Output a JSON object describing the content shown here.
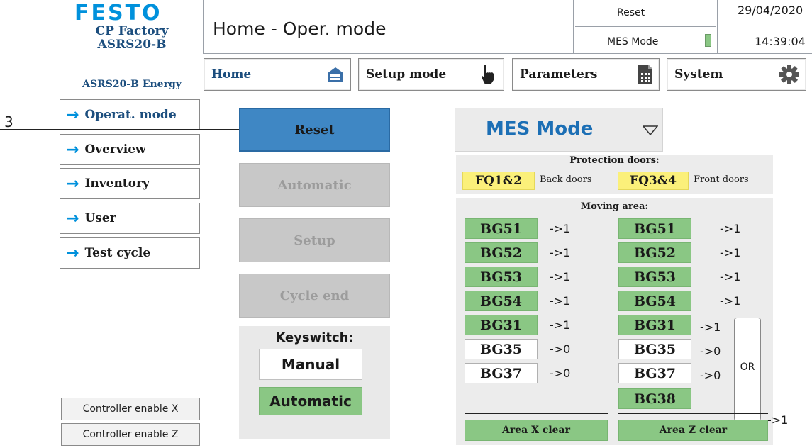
{
  "header": {
    "brand": "FESTO",
    "line1": "CP Factory",
    "line2": "ASRS20-B",
    "line3": "ASRS20-B Energy",
    "title": "Home - Oper. mode",
    "reset": "Reset",
    "mes_mode": "MES Mode",
    "date": "29/04/2020",
    "time": "14:39:04"
  },
  "nav": {
    "home": "Home",
    "setup": "Setup mode",
    "parameters": "Parameters",
    "system": "System"
  },
  "sidebar": {
    "items": [
      "Operat. mode",
      "Overview",
      "Inventory",
      "User",
      "Test cycle"
    ],
    "controller_x": "Controller enable X",
    "controller_z": "Controller enable Z"
  },
  "callout": "3",
  "modes": {
    "reset": "Reset",
    "automatic": "Automatic",
    "setup": "Setup",
    "cycle_end": "Cycle end"
  },
  "keyswitch": {
    "label": "Keyswitch:",
    "manual": "Manual",
    "automatic": "Automatic"
  },
  "mes_select": "MES Mode",
  "doors": {
    "title": "Protection doors:",
    "fq12": "FQ1&2",
    "back": "Back doors",
    "fq34": "FQ3&4",
    "front": "Front doors"
  },
  "moving": {
    "title": "Moving area:",
    "left": [
      {
        "tag": "BG51",
        "val": "->1"
      },
      {
        "tag": "BG52",
        "val": "->1"
      },
      {
        "tag": "BG53",
        "val": "->1"
      },
      {
        "tag": "BG54",
        "val": "->1"
      },
      {
        "tag": "BG31",
        "val": "->1"
      },
      {
        "tag": "BG35",
        "val": "->0"
      },
      {
        "tag": "BG37",
        "val": "->0"
      }
    ],
    "right": [
      {
        "tag": "BG51",
        "val": "->1"
      },
      {
        "tag": "BG52",
        "val": "->1"
      },
      {
        "tag": "BG53",
        "val": "->1"
      },
      {
        "tag": "BG54",
        "val": "->1"
      },
      {
        "tag": "BG31",
        "val": "->1"
      },
      {
        "tag": "BG35",
        "val": "->0"
      },
      {
        "tag": "BG37",
        "val": "->0"
      },
      {
        "tag": "BG38",
        "val": "->1"
      }
    ],
    "or": "OR"
  },
  "areas": {
    "x": "Area X clear",
    "z": "Area Z clear"
  },
  "colors": {
    "brand": "#0091dc",
    "navy": "#1c4e7e",
    "green": "#8ac784",
    "yellow": "#fbf07a",
    "reset_blue": "#3f87c4"
  }
}
